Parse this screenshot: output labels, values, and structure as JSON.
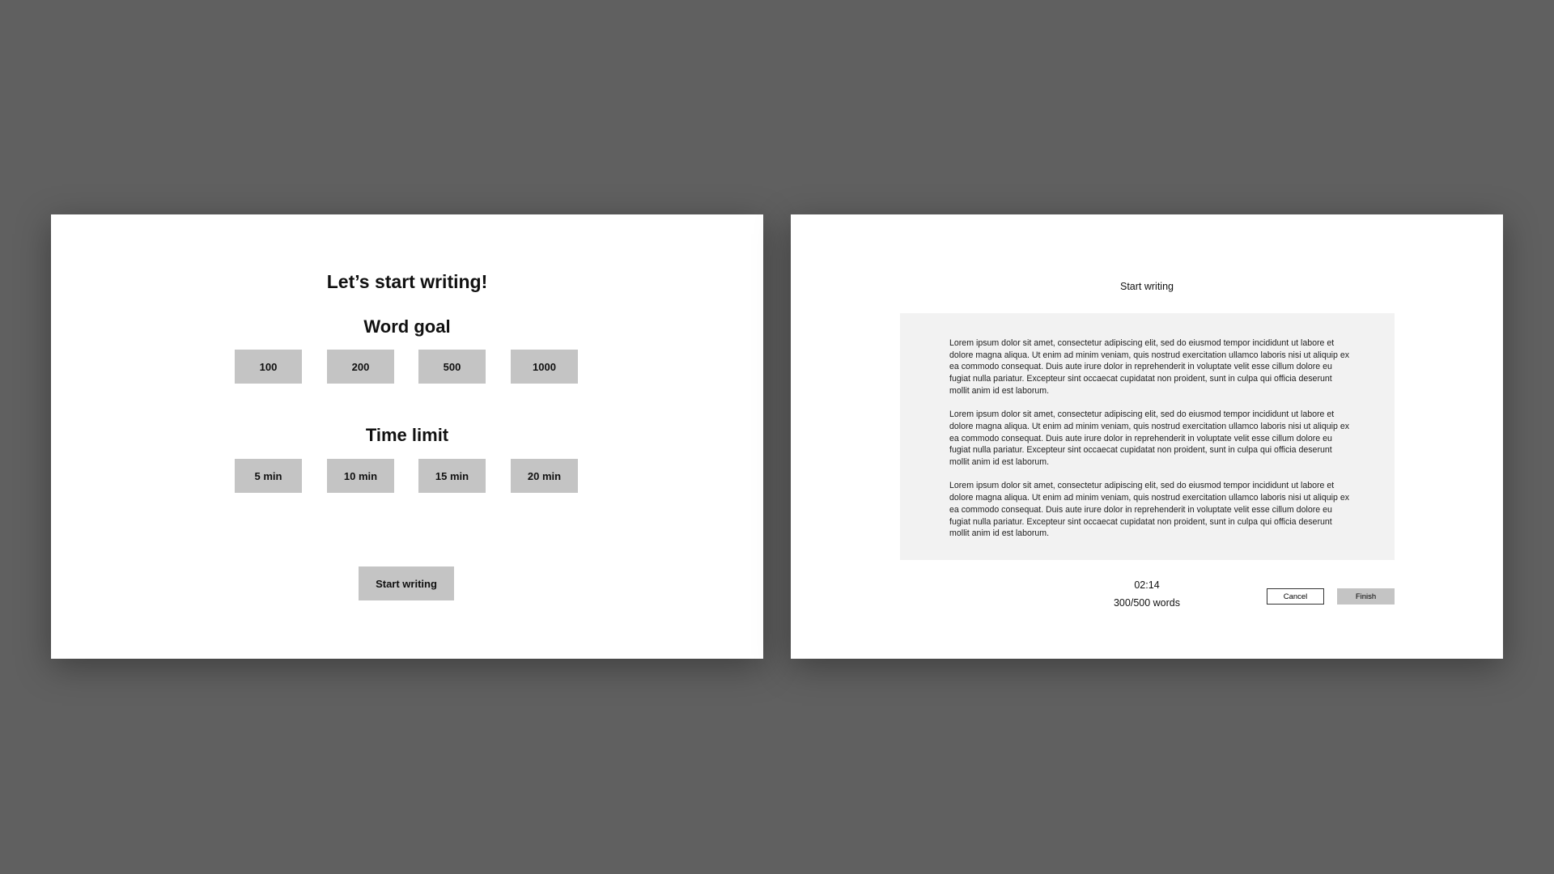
{
  "setup_screen": {
    "title": "Let’s start writing!",
    "word_goal": {
      "heading": "Word goal",
      "options": [
        "100",
        "200",
        "500",
        "1000"
      ]
    },
    "time_limit": {
      "heading": "Time limit",
      "options": [
        "5 min",
        "10 min",
        "15 min",
        "20 min"
      ]
    },
    "start_button": "Start writing"
  },
  "writing_screen": {
    "title": "Start writing",
    "paragraphs": [
      "Lorem ipsum dolor sit amet, consectetur adipiscing elit, sed do eiusmod tempor incididunt ut labore et dolore magna aliqua. Ut enim ad minim veniam, quis nostrud exercitation ullamco laboris nisi ut aliquip ex ea commodo consequat. Duis aute irure dolor in reprehenderit in voluptate velit esse cillum dolore eu fugiat nulla pariatur. Excepteur sint occaecat cupidatat non proident, sunt in culpa qui officia deserunt mollit anim id est laborum.",
      "Lorem ipsum dolor sit amet, consectetur adipiscing elit, sed do eiusmod tempor incididunt ut labore et dolore magna aliqua. Ut enim ad minim veniam, quis nostrud exercitation ullamco laboris nisi ut aliquip ex ea commodo consequat. Duis aute irure dolor in reprehenderit in voluptate velit esse cillum dolore eu fugiat nulla pariatur. Excepteur sint occaecat cupidatat non proident, sunt in culpa qui officia deserunt mollit anim id est laborum.",
      "Lorem ipsum dolor sit amet, consectetur adipiscing elit, sed do eiusmod tempor incididunt ut labore et dolore magna aliqua. Ut enim ad minim veniam, quis nostrud exercitation ullamco laboris nisi ut aliquip ex ea commodo consequat. Duis aute irure dolor in reprehenderit in voluptate velit esse cillum dolore eu fugiat nulla pariatur. Excepteur sint occaecat cupidatat non proident, sunt in culpa qui officia deserunt mollit anim id est laborum."
    ],
    "timer": "02:14",
    "word_count": "300/500 words",
    "cancel_button": "Cancel",
    "finish_button": "Finish"
  },
  "colors": {
    "background": "#606060",
    "button_fill": "#c4c4c4",
    "editor_fill": "#f2f2f2"
  }
}
